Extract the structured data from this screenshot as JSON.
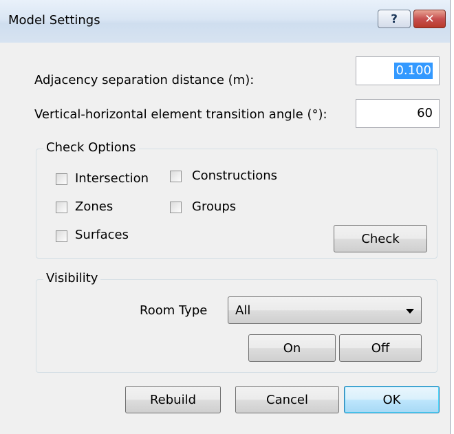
{
  "window": {
    "title": "Model Settings",
    "help_label": "?",
    "close_label": "✕"
  },
  "fields": {
    "adjacency": {
      "label": "Adjacency separation distance (m):",
      "value": "0.100"
    },
    "transition": {
      "label": "Vertical-horizontal element transition angle (°):",
      "value": "60"
    }
  },
  "check_options": {
    "title": "Check Options",
    "items": [
      {
        "label": "Intersection",
        "checked": false
      },
      {
        "label": "Constructions",
        "checked": false
      },
      {
        "label": "Zones",
        "checked": false
      },
      {
        "label": "Groups",
        "checked": false
      },
      {
        "label": "Surfaces",
        "checked": false
      }
    ],
    "check_button": "Check"
  },
  "visibility": {
    "title": "Visibility",
    "room_type_label": "Room Type",
    "room_type_value": "All",
    "on_button": "On",
    "off_button": "Off"
  },
  "footer": {
    "rebuild": "Rebuild",
    "cancel": "Cancel",
    "ok": "OK"
  }
}
